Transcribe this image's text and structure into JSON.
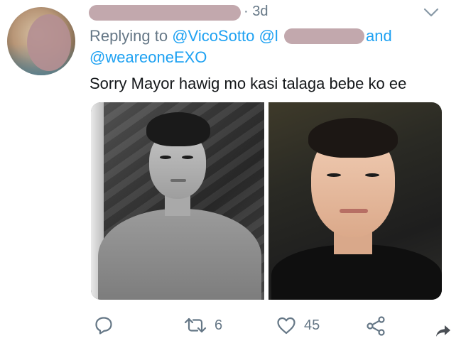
{
  "tweet": {
    "time_sep": "·",
    "time": "3d",
    "replying_prefix": "Replying to",
    "handle_1": "@VicoSotto",
    "handle_2_visible": "@l",
    "and_label": "and",
    "handle_3": "@weareoneEXO",
    "text": "Sorry Mayor hawig mo kasi talaga bebe ko ee"
  },
  "actions": {
    "reply_count": "",
    "retweet_count": "6",
    "like_count": "45"
  },
  "icons": {
    "menu": "chevron-down-icon",
    "reply": "speech-bubble-icon",
    "retweet": "retweet-icon",
    "like": "heart-icon",
    "share": "share-nodes-icon",
    "send": "forward-arrow-icon"
  },
  "colors": {
    "link": "#1da1f2",
    "muted": "#657786",
    "text": "#14171a",
    "redaction": "#c2a8ad"
  }
}
